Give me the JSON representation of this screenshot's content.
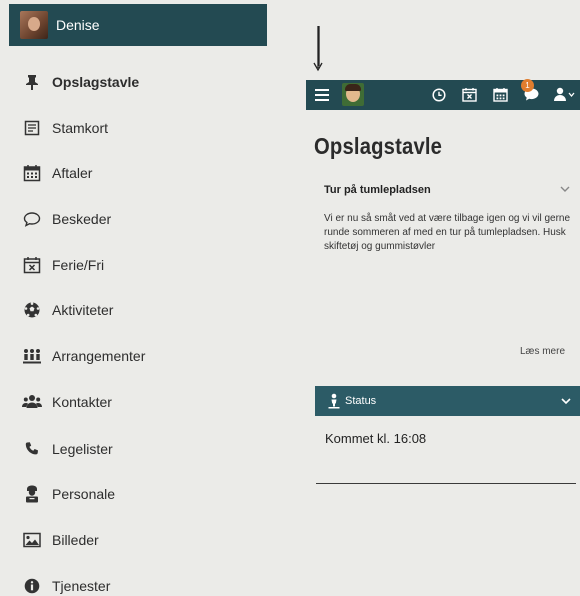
{
  "user": {
    "name": "Denise"
  },
  "menu": {
    "items": [
      {
        "label": "Opslagstavle",
        "icon": "pin-icon",
        "active": true
      },
      {
        "label": "Stamkort",
        "icon": "card-icon"
      },
      {
        "label": "Aftaler",
        "icon": "calendar-icon"
      },
      {
        "label": "Beskeder",
        "icon": "chat-bubble-icon"
      },
      {
        "label": "Ferie/Fri",
        "icon": "calendar-x-icon"
      },
      {
        "label": "Aktiviteter",
        "icon": "soccer-ball-icon"
      },
      {
        "label": "Arrangementer",
        "icon": "people-group-icon"
      },
      {
        "label": "Kontakter",
        "icon": "contacts-icon"
      },
      {
        "label": "Legelister",
        "icon": "phone-icon"
      },
      {
        "label": "Personale",
        "icon": "staff-icon"
      },
      {
        "label": "Billeder",
        "icon": "image-icon"
      },
      {
        "label": "Tjenester",
        "icon": "info-icon"
      }
    ]
  },
  "topbar": {
    "icons": [
      "menu-icon",
      "avatar",
      "clock-icon",
      "calendar-icon",
      "calendar-icon",
      "chat-icon",
      "user-icon"
    ],
    "badge": "1"
  },
  "page": {
    "title": "Opslagstavle"
  },
  "post": {
    "title": "Tur på tumlepladsen",
    "body": "Vi er nu så småt ved at være tilbage igen og vi vil gerne runde sommeren af med en tur på tumlepladsen. Husk skiftetøj og gummistøvler",
    "read_more": "Læs mere"
  },
  "status": {
    "label": "Status",
    "text": "Kommet kl. 16:08"
  },
  "colors": {
    "header": "#234a52",
    "status_header": "#2c5b66",
    "badge": "#e07d2e"
  }
}
